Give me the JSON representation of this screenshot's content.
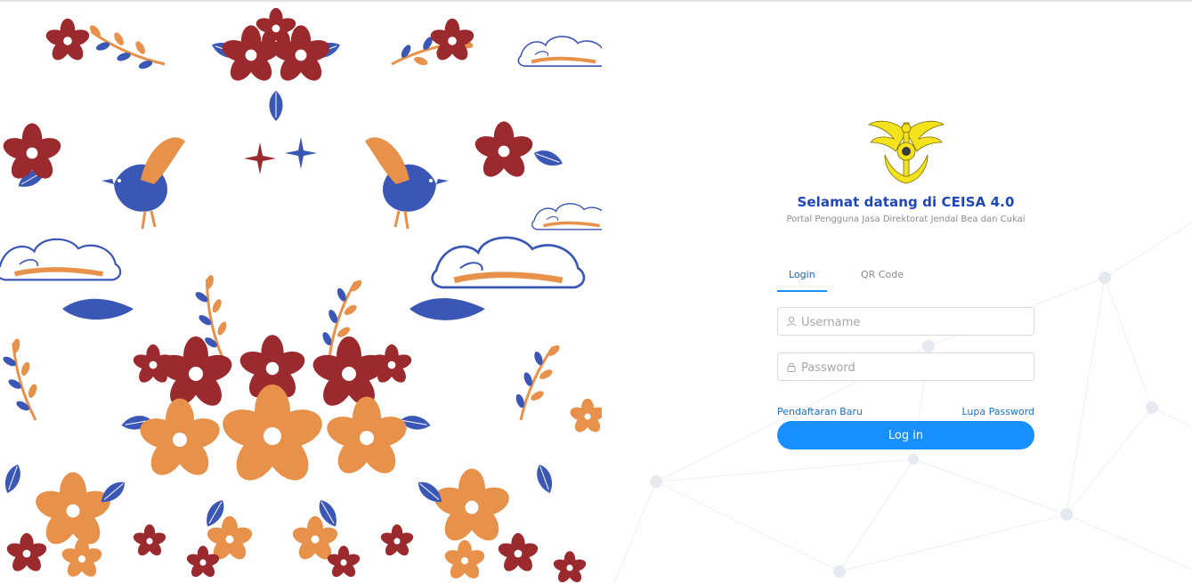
{
  "login": {
    "title": "Selamat datang di CEISA 4.0",
    "subtitle": "Portal Pengguna Jasa Direktorat Jendal Bea dan Cukai",
    "tabs": [
      {
        "label": "Login",
        "active": true
      },
      {
        "label": "QR Code",
        "active": false
      }
    ],
    "username_placeholder": "Username",
    "password_placeholder": "Password",
    "register_link": "Pendaftaran Baru",
    "forgot_link": "Lupa Password",
    "submit_label": "Log in"
  },
  "icons": {
    "logo": "customs-emblem-icon",
    "username": "user-icon",
    "password": "lock-icon"
  },
  "colors": {
    "title": "#1f47b8",
    "accent": "#1890ff",
    "link": "#1f6fd1",
    "batik_red": "#9b2a2e",
    "batik_orange": "#e8914a",
    "batik_blue": "#3b57b5",
    "emblem_yellow": "#f4e21d"
  }
}
